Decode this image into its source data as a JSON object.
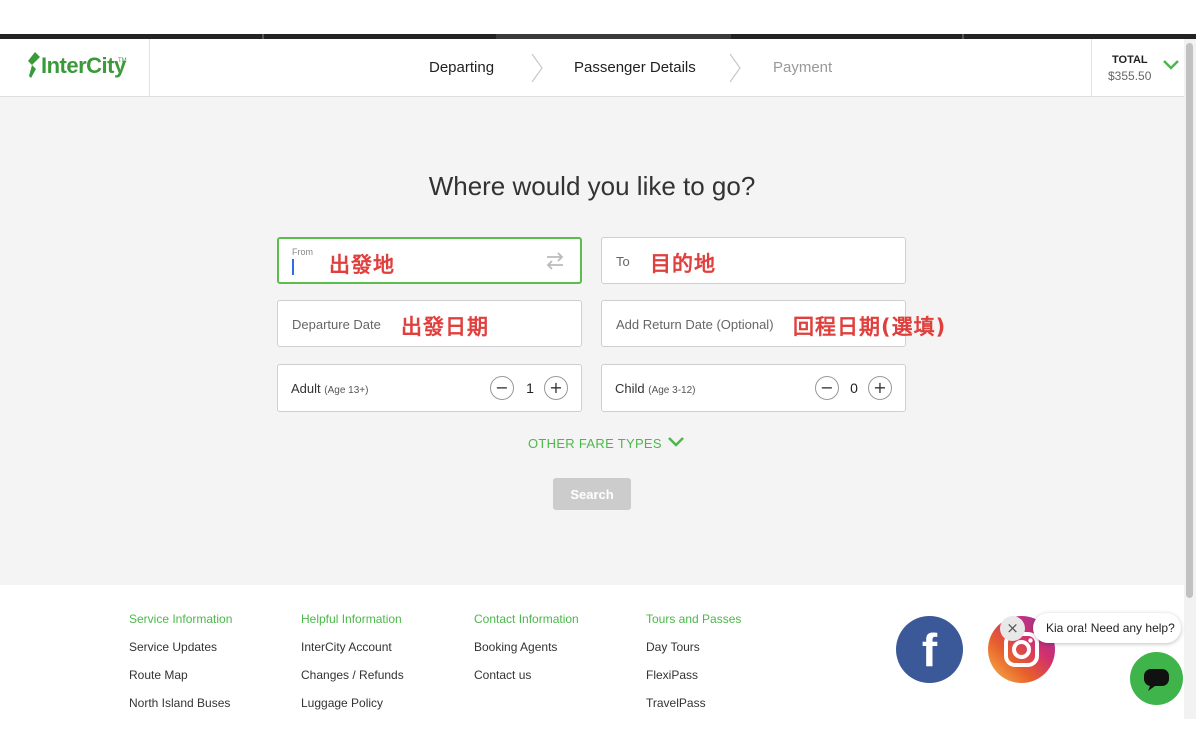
{
  "header": {
    "logo_text": "InterCity",
    "logo_tm": "TM",
    "steps": [
      {
        "label": "Departing",
        "state": "active"
      },
      {
        "label": "Passenger Details",
        "state": "active"
      },
      {
        "label": "Payment",
        "state": "inactive"
      }
    ],
    "total_label": "TOTAL",
    "total_value": "$355.50"
  },
  "main": {
    "heading": "Where would you like to go?",
    "from": {
      "small_label": "From",
      "annotation": "出發地"
    },
    "to": {
      "label": "To",
      "annotation": "目的地"
    },
    "departure_date": {
      "label": "Departure Date",
      "annotation": "出發日期"
    },
    "return_date": {
      "label": "Add Return Date (Optional)",
      "annotation": "回程日期(選填)"
    },
    "adult": {
      "label": "Adult",
      "age": "(Age 13+)",
      "count": "1"
    },
    "child": {
      "label": "Child",
      "age": "(Age 3-12)",
      "count": "0"
    },
    "minus_glyph": "−",
    "plus_glyph": "+",
    "other_fare_types": "OTHER FARE TYPES",
    "search_label": "Search"
  },
  "footer": {
    "columns": [
      {
        "title": "Service Information",
        "links": [
          "Service Updates",
          "Route Map",
          "North Island Buses"
        ]
      },
      {
        "title": "Helpful Information",
        "links": [
          "InterCity Account",
          "Changes / Refunds",
          "Luggage Policy"
        ]
      },
      {
        "title": "Contact Information",
        "links": [
          "Booking Agents",
          "Contact us"
        ]
      },
      {
        "title": "Tours and Passes",
        "links": [
          "Day Tours",
          "FlexiPass",
          "TravelPass"
        ]
      }
    ],
    "facebook_glyph": "f",
    "chat_message": "Kia ora! Need any help?",
    "chat_close_glyph": "×"
  },
  "colors": {
    "brand_green": "#4bb84a",
    "focus_border": "#5cbd4e",
    "annotation_red": "#e0403d",
    "facebook_blue": "#3b5998"
  },
  "icons": [
    "intercity-logo-icon",
    "chevron-right-icon",
    "chevron-down-icon",
    "swap-icon",
    "facebook-icon",
    "instagram-icon",
    "chat-icon",
    "close-icon"
  ]
}
